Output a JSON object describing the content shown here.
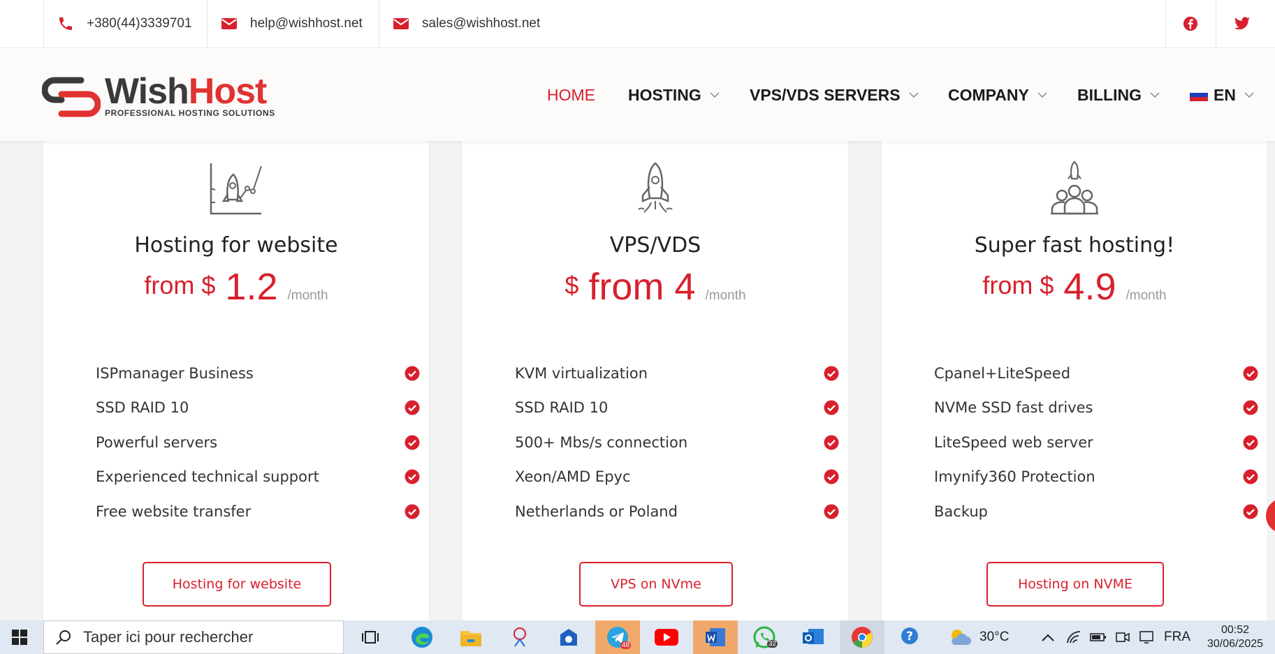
{
  "topbar": {
    "phone": "+380(44)3339701",
    "email_help": "help@wishhost.net",
    "email_sales": "sales@wishhost.net",
    "social": [
      "facebook-icon",
      "twitter-icon"
    ]
  },
  "header": {
    "logo_word1": "Wish",
    "logo_word2": "Host",
    "logo_tagline": "PROFESSIONAL HOSTING SOLUTIONS",
    "nav": {
      "home": "HOME",
      "hosting": "HOSTING",
      "vps": "VPS/VDS SERVERS",
      "company": "COMPANY",
      "billing": "BILLING",
      "lang": "EN"
    }
  },
  "cards": [
    {
      "title": "Hosting for website",
      "from": "from $",
      "amount": "1.2",
      "period": "/month",
      "features": [
        "ISPmanager Business",
        "SSD RAID 10",
        "Powerful servers",
        "Experienced technical support",
        "Free website transfer"
      ],
      "button": "Hosting for website"
    },
    {
      "title": "VPS/VDS",
      "currency": "$",
      "amount": "from 4",
      "period": "/month",
      "features": [
        "KVM virtualization",
        "SSD RAID 10",
        "500+ Mbs/s connection",
        "Xeon/AMD Epyc",
        "Netherlands or Poland"
      ],
      "button": "VPS on NVme"
    },
    {
      "title": "Super fast hosting!",
      "from": "from $",
      "amount": "4.9",
      "period": "/month",
      "features": [
        "Cpanel+LiteSpeed",
        "NVMe SSD fast drives",
        "LiteSpeed web server",
        "Imynify360 Protection",
        "Backup"
      ],
      "button": "Hosting on NVME"
    }
  ],
  "taskbar": {
    "search_placeholder": "Taper ici pour rechercher",
    "telegram_badge": "48",
    "whatsapp_badge": "32",
    "weather": "30°C",
    "lang": "FRA",
    "time": "00:52",
    "date": "30/06/2025"
  },
  "colors": {
    "accent": "#d8202d",
    "logo_dark": "#3a3a3a"
  }
}
